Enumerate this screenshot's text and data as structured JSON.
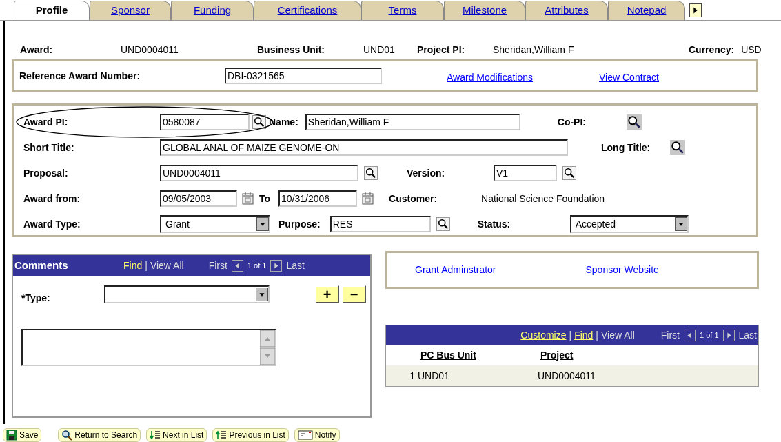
{
  "tabs": [
    {
      "label": "Profile",
      "selected": true
    },
    {
      "label": "Sponsor",
      "selected": false
    },
    {
      "label": "Funding",
      "selected": false
    },
    {
      "label": "Certifications",
      "selected": false
    },
    {
      "label": "Terms",
      "selected": false
    },
    {
      "label": "Milestone",
      "selected": false
    },
    {
      "label": "Attributes",
      "selected": false
    },
    {
      "label": "Notepad",
      "selected": false
    }
  ],
  "header": [
    {
      "label": "Award:",
      "value": "UND0004011"
    },
    {
      "label": "Business Unit:",
      "value": "UND01"
    },
    {
      "label": "Project PI:",
      "value": "Sheridan,William F"
    },
    {
      "label": "Currency:",
      "value": "USD"
    }
  ],
  "reference": {
    "label": "Reference Award Number:",
    "value": "DBI-0321565",
    "links": [
      "Award Modifications",
      "View Contract"
    ]
  },
  "award_details": {
    "award_pi": {
      "label": "Award PI:",
      "value": "0580087"
    },
    "name": {
      "label": "Name:",
      "value": "Sheridan,William F"
    },
    "co_pi": {
      "label": "Co-PI:"
    },
    "short_title": {
      "label": "Short Title:",
      "value": "GLOBAL ANAL OF MAIZE GENOME-ON"
    },
    "long_title": {
      "label": "Long Title:"
    },
    "proposal": {
      "label": "Proposal:",
      "value": "UND0004011"
    },
    "version": {
      "label": "Version:",
      "value": "V1"
    },
    "award_from": {
      "label": "Award from:",
      "value": "09/05/2003"
    },
    "to": {
      "label": "To",
      "value": "10/31/2006"
    },
    "customer": {
      "label": "Customer:",
      "value": "National Science Foundation"
    },
    "award_type": {
      "label": "Award Type:",
      "value": "Grant"
    },
    "purpose": {
      "label": "Purpose:",
      "value": "RES"
    },
    "status": {
      "label": "Status:",
      "value": "Accepted"
    }
  },
  "comments": {
    "title": "Comments",
    "find": "Find",
    "separator": "|",
    "view_all": "View All",
    "first": "First",
    "count": "1 of 1",
    "last": "Last",
    "type_label": "*Type:",
    "add": "+",
    "remove": "−"
  },
  "links": [
    "Grant Adminstrator",
    "Sponsor Website"
  ],
  "grid": {
    "customize": "Customize",
    "separators": [
      "|",
      "|"
    ],
    "find": "Find",
    "view_all": "View All",
    "first": "First",
    "count": "1 of 1",
    "last": "Last",
    "columns": [
      "PC Bus Unit",
      "Project"
    ],
    "rows": [
      {
        "row_number": "1",
        "pc_bus_unit": "UND01",
        "project": "UND0004011"
      }
    ]
  },
  "toolbar": [
    {
      "kind": "save",
      "label": "Save"
    },
    {
      "kind": "search",
      "label": "Return to Search"
    },
    {
      "kind": "next",
      "label": "Next in List"
    },
    {
      "kind": "previous",
      "label": "Previous in List"
    },
    {
      "kind": "notify",
      "label": "Notify"
    }
  ]
}
